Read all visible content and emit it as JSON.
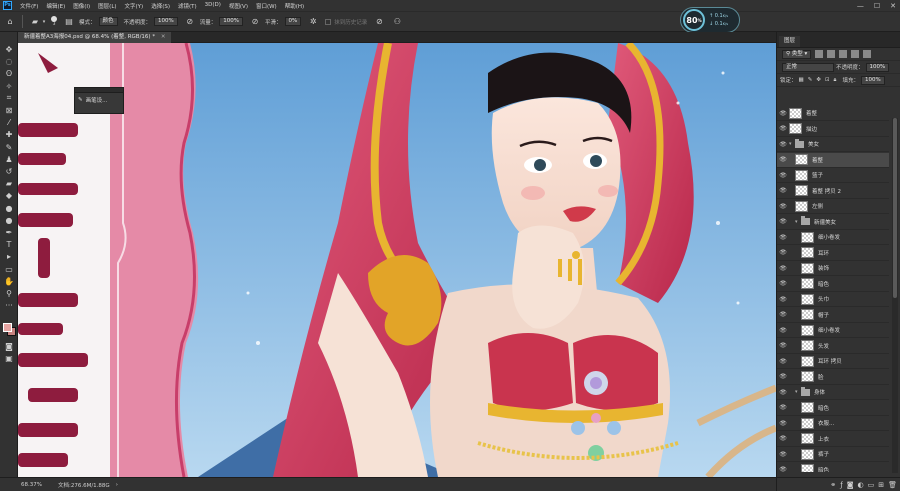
{
  "menu": {
    "items": [
      "文件(F)",
      "编辑(E)",
      "图像(I)",
      "图层(L)",
      "文字(Y)",
      "选择(S)",
      "滤镜(T)",
      "3D(D)",
      "视图(V)",
      "窗口(W)",
      "帮助(H)"
    ],
    "window_controls": [
      "—",
      "☐",
      "✕"
    ]
  },
  "options": {
    "brush_size": "3",
    "mode_label": "模式：",
    "mode_value": "颜色",
    "opacity_label": "不透明度：",
    "opacity_value": "100%",
    "flow_label": "流量：",
    "flow_value": "100%",
    "smooth_label": "平滑：",
    "smooth_value": "0%",
    "history_label": "抹到历史记录"
  },
  "tab": {
    "title": "新疆着整A3海报04.psd @ 68.4% (着整, RGB/16) *",
    "close": "✕"
  },
  "tools": [
    {
      "icon": "move-icon",
      "glyph": "✥"
    },
    {
      "icon": "marquee-icon",
      "glyph": "◌"
    },
    {
      "icon": "lasso-icon",
      "glyph": "ʘ"
    },
    {
      "icon": "magic-wand-icon",
      "glyph": "✧"
    },
    {
      "icon": "crop-icon",
      "glyph": "⌗"
    },
    {
      "icon": "frame-icon",
      "glyph": "⊠"
    },
    {
      "icon": "eyedropper-icon",
      "glyph": "⁄"
    },
    {
      "icon": "healing-icon",
      "glyph": "✚"
    },
    {
      "icon": "brush-icon",
      "glyph": "✎"
    },
    {
      "icon": "stamp-icon",
      "glyph": "♟"
    },
    {
      "icon": "history-brush-icon",
      "glyph": "↺"
    },
    {
      "icon": "eraser-icon",
      "glyph": "▰"
    },
    {
      "icon": "bucket-icon",
      "glyph": "◆"
    },
    {
      "icon": "blur-icon",
      "glyph": "●"
    },
    {
      "icon": "dodge-icon",
      "glyph": "●"
    },
    {
      "icon": "pen-icon",
      "glyph": "✒"
    },
    {
      "icon": "type-icon",
      "glyph": "T"
    },
    {
      "icon": "path-select-icon",
      "glyph": "▸"
    },
    {
      "icon": "rect-shape-icon",
      "glyph": "▭"
    },
    {
      "icon": "hand-icon",
      "glyph": "✋"
    },
    {
      "icon": "zoom-icon",
      "glyph": "⚲"
    },
    {
      "icon": "more-icon",
      "glyph": "···"
    }
  ],
  "floating_panel": {
    "label": "画笔设..."
  },
  "status": {
    "zoom": "68.37%",
    "doc": "文档:276.6M/1.88G",
    "arrow": "›"
  },
  "perf": {
    "value": "80",
    "unit": "%",
    "up": "0.1",
    "down": "0.1",
    "up_unit": "K/s",
    "down_unit": "K/s"
  },
  "layers_panel": {
    "tab": "图层",
    "filter_label": "类型",
    "blend_mode": "正常",
    "opacity_label": "不透明度：",
    "opacity_value": "100%",
    "lock_label": "锁定：",
    "fill_label": "填充：",
    "fill_value": "100%",
    "layers": [
      {
        "name": "着整",
        "type": "layer",
        "indent": 0,
        "selected": false
      },
      {
        "name": "描边",
        "type": "layer",
        "indent": 0,
        "selected": false
      },
      {
        "name": "美女",
        "type": "group",
        "indent": 0,
        "selected": false
      },
      {
        "name": "着整",
        "type": "layer",
        "indent": 1,
        "selected": true
      },
      {
        "name": "篮子",
        "type": "layer",
        "indent": 1,
        "selected": false
      },
      {
        "name": "着整 拷贝 2",
        "type": "layer",
        "indent": 1,
        "selected": false
      },
      {
        "name": "左侧",
        "type": "layer",
        "indent": 1,
        "selected": false
      },
      {
        "name": "新疆美女",
        "type": "group",
        "indent": 1,
        "selected": false
      },
      {
        "name": "细小卷发",
        "type": "layer",
        "indent": 2,
        "selected": false
      },
      {
        "name": "耳环",
        "type": "layer",
        "indent": 2,
        "selected": false
      },
      {
        "name": "装饰",
        "type": "layer",
        "indent": 2,
        "selected": false
      },
      {
        "name": "暗色",
        "type": "layer",
        "indent": 2,
        "selected": false
      },
      {
        "name": "头巾",
        "type": "layer",
        "indent": 2,
        "selected": false
      },
      {
        "name": "帽子",
        "type": "layer",
        "indent": 2,
        "selected": false
      },
      {
        "name": "细小卷发",
        "type": "layer",
        "indent": 2,
        "selected": false
      },
      {
        "name": "头发",
        "type": "layer",
        "indent": 2,
        "selected": false
      },
      {
        "name": "耳环 拷贝",
        "type": "layer",
        "indent": 2,
        "selected": false
      },
      {
        "name": "脸",
        "type": "layer",
        "indent": 2,
        "selected": false
      },
      {
        "name": "身体",
        "type": "group",
        "indent": 1,
        "selected": false
      },
      {
        "name": "暗色",
        "type": "layer",
        "indent": 2,
        "selected": false
      },
      {
        "name": "衣服...",
        "type": "layer",
        "indent": 2,
        "selected": false
      },
      {
        "name": "上衣",
        "type": "layer",
        "indent": 2,
        "selected": false
      },
      {
        "name": "裤子",
        "type": "layer",
        "indent": 2,
        "selected": false
      },
      {
        "name": "暗色",
        "type": "layer",
        "indent": 2,
        "selected": false
      }
    ]
  },
  "colors": {
    "foreground": "#e7a5a3",
    "background": "#c7827f",
    "accent": "#31a8ff"
  }
}
